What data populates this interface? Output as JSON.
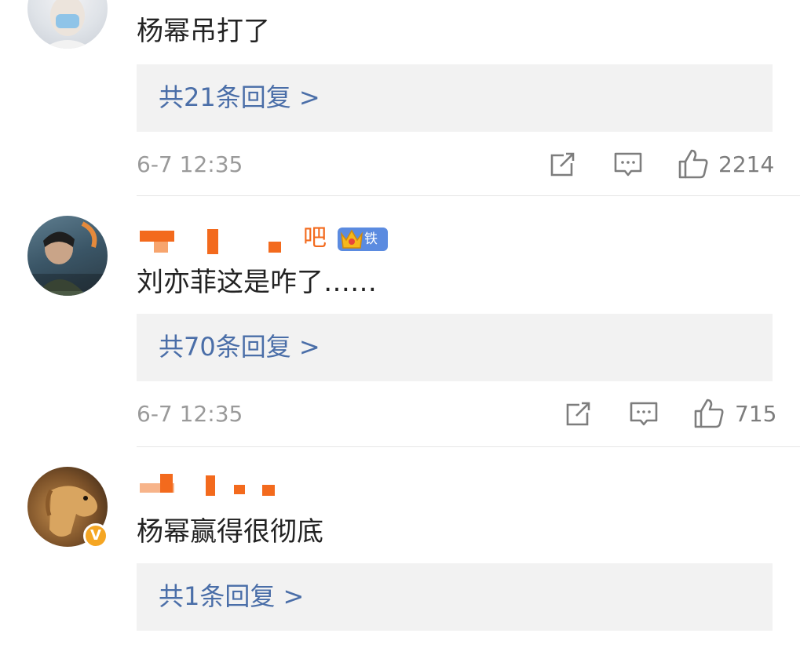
{
  "comments": [
    {
      "text": "杨幂吊打了",
      "replies": "共21条回复 >",
      "time": "6-7 12:35",
      "likes": "2214"
    },
    {
      "name_tail": "吧",
      "badge": "铁粉",
      "text": "刘亦菲这是咋了……",
      "replies": "共70条回复 >",
      "time": "6-7 12:35",
      "likes": "715"
    },
    {
      "verified_mark": "V",
      "text": "杨幂赢得很彻底",
      "replies": "共1条回复 >"
    }
  ],
  "colors": {
    "link": "#4a6ea8",
    "username_orange": "#f36a1d",
    "badge_blue": "#5b8be0",
    "verified_gold": "#f5a623"
  }
}
